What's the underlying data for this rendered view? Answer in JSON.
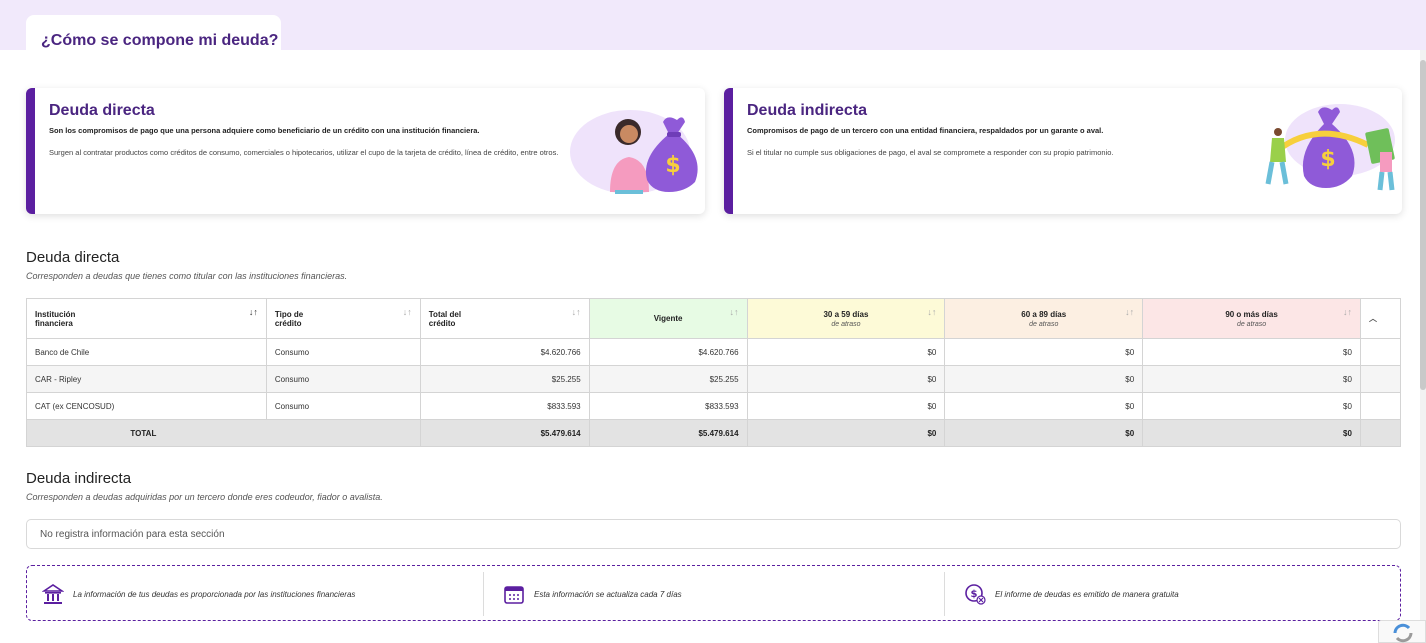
{
  "page": {
    "title": "¿Cómo se compone mi deuda?"
  },
  "cards": [
    {
      "title": "Deuda directa",
      "lead": "Son los compromisos de pago que una persona adquiere como beneficiario de un crédito con una institución financiera.",
      "desc": "Surgen al contratar productos como créditos de consumo, comerciales o hipotecarios, utilizar el cupo de la tarjeta de crédito, línea de crédito, entre otros."
    },
    {
      "title": "Deuda indirecta",
      "lead": "Compromisos de pago de un tercero con una entidad financiera, respaldados por un garante o aval.",
      "desc": "Si el titular no cumple sus obligaciones de pago, el aval se compromete a responder con su propio patrimonio."
    }
  ],
  "direct": {
    "title": "Deuda directa",
    "subtitle": "Corresponden a deudas que tienes como titular con las instituciones financieras.",
    "headers": {
      "institution": "Institución financiera",
      "type": "Tipo de crédito",
      "total": "Total del crédito",
      "vigente": "Vigente",
      "d30": "30 a 59 días",
      "d60": "60 a 89 días",
      "d90": "90 o más días",
      "late": "de atraso"
    },
    "rows": [
      {
        "institution": "Banco de Chile",
        "type": "Consumo",
        "total": "$4.620.766",
        "vigente": "$4.620.766",
        "d30": "$0",
        "d60": "$0",
        "d90": "$0"
      },
      {
        "institution": "CAR - Ripley",
        "type": "Consumo",
        "total": "$25.255",
        "vigente": "$25.255",
        "d30": "$0",
        "d60": "$0",
        "d90": "$0"
      },
      {
        "institution": "CAT (ex CENCOSUD)",
        "type": "Consumo",
        "total": "$833.593",
        "vigente": "$833.593",
        "d30": "$0",
        "d60": "$0",
        "d90": "$0"
      }
    ],
    "total": {
      "label": "TOTAL",
      "total": "$5.479.614",
      "vigente": "$5.479.614",
      "d30": "$0",
      "d60": "$0",
      "d90": "$0"
    }
  },
  "indirect": {
    "title": "Deuda indirecta",
    "subtitle": "Corresponden a deudas adquiridas por un tercero donde eres codeudor, fiador o avalista.",
    "empty": "No registra información para esta sección"
  },
  "info": [
    {
      "icon": "bank-icon",
      "text": "La información de tus deudas es proporcionada por las instituciones financieras"
    },
    {
      "icon": "calendar-icon",
      "text": "Esta información se actualiza cada 7 días"
    },
    {
      "icon": "free-coin-icon",
      "text": "El informe de deudas es emitido de manera gratuita"
    }
  ],
  "colors": {
    "brand": "#5b1fa0",
    "title": "#4a2580",
    "band": "#f1e9fb"
  }
}
